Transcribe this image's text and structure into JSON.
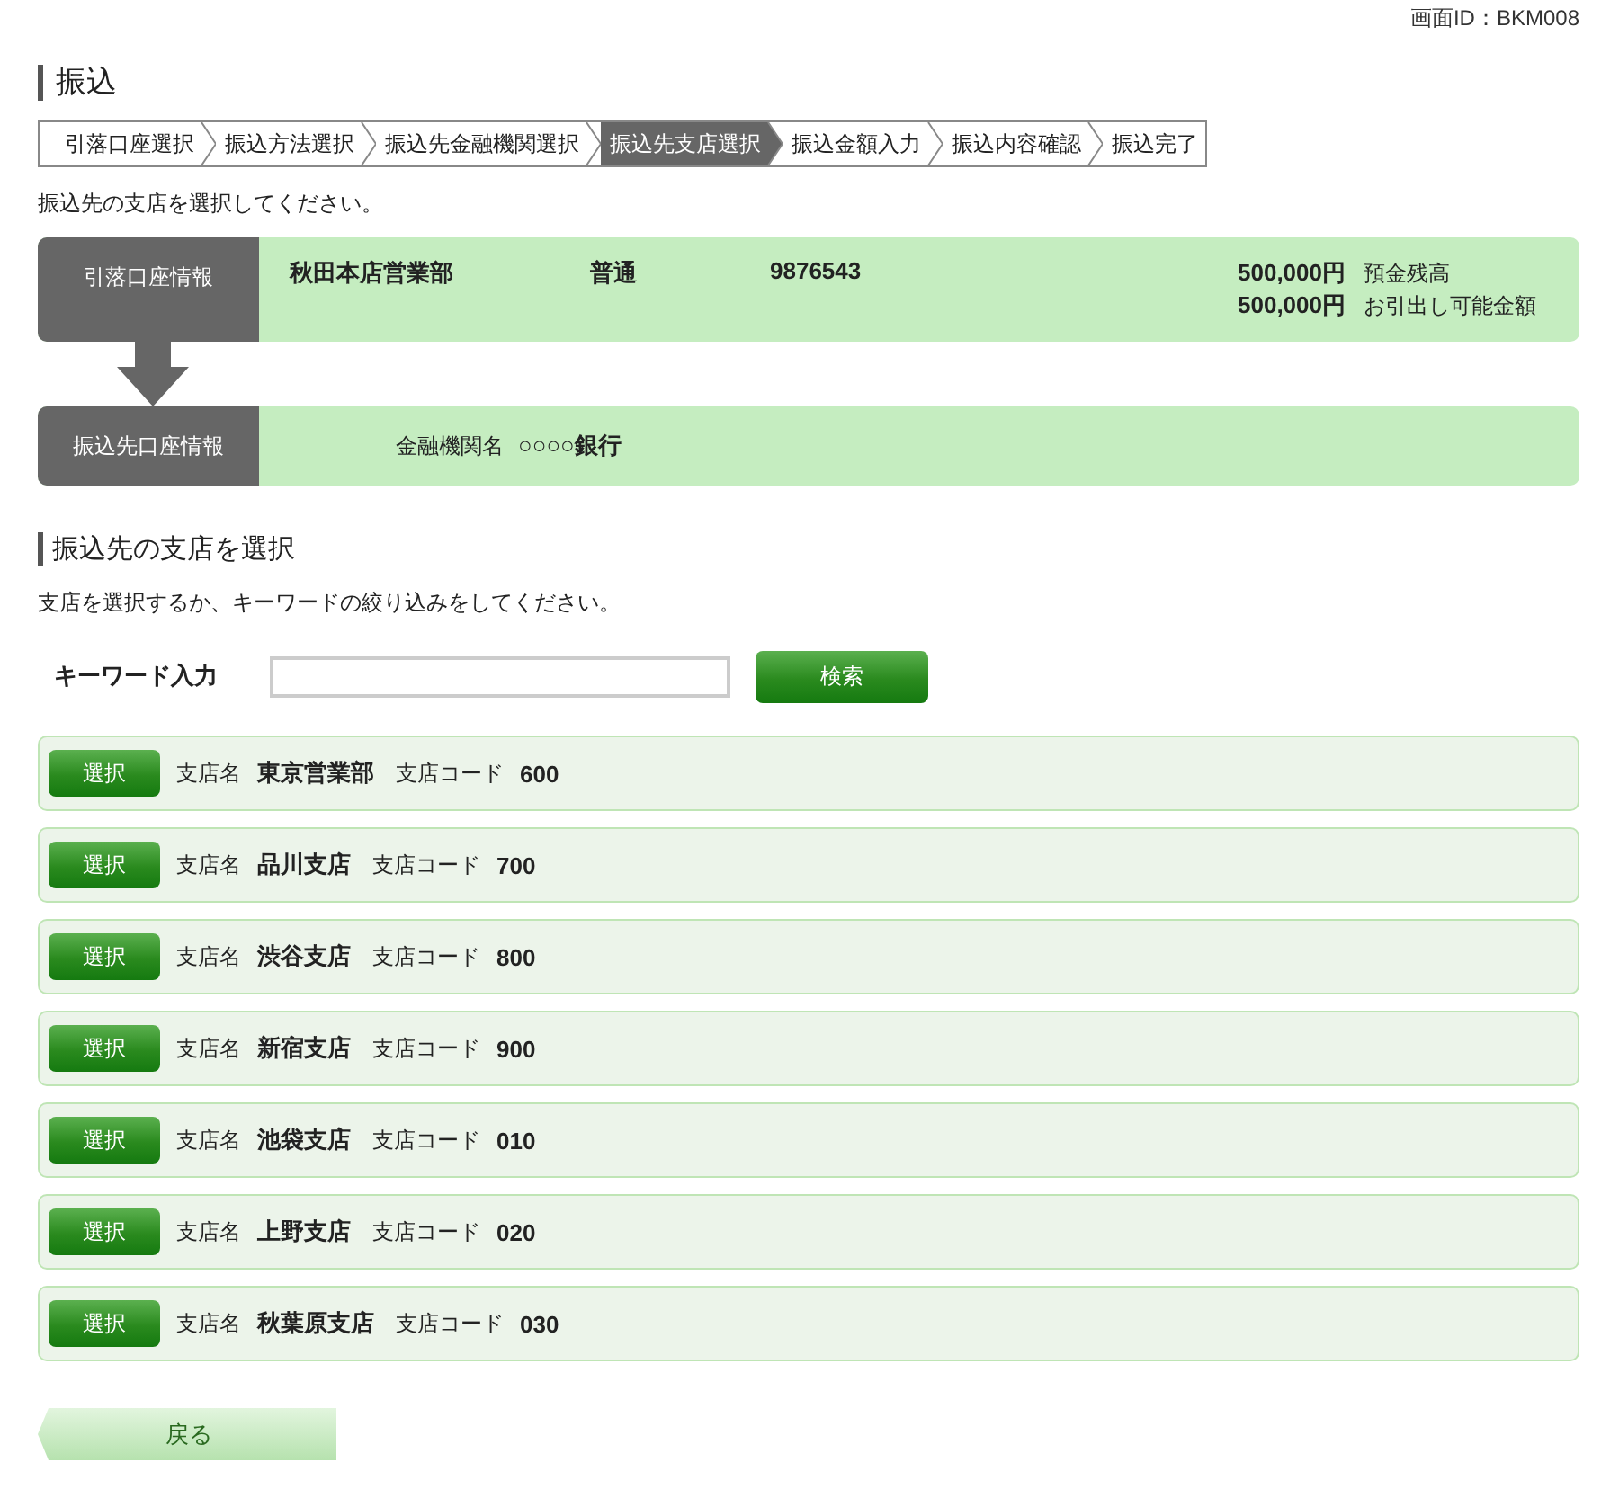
{
  "screen_id": "画面ID：BKM008",
  "title": "振込",
  "steps": [
    {
      "label": "引落口座選択",
      "selected": false
    },
    {
      "label": "振込方法選択",
      "selected": false
    },
    {
      "label": "振込先金融機関選択",
      "selected": false
    },
    {
      "label": "振込先支店選択",
      "selected": true
    },
    {
      "label": "振込金額入力",
      "selected": false
    },
    {
      "label": "振込内容確認",
      "selected": false
    },
    {
      "label": "振込完了",
      "selected": false
    }
  ],
  "instruction": "振込先の支店を選択してください。",
  "debit_account": {
    "label": "引落口座情報",
    "branch": "秋田本店営業部",
    "type": "普通",
    "number": "9876543",
    "balances": [
      {
        "amount": "500,000円",
        "label": "預金残高"
      },
      {
        "amount": "500,000円",
        "label": "お引出し可能金額"
      }
    ]
  },
  "transfer_account": {
    "label": "振込先口座情報",
    "bank_label": "金融機関名",
    "bank_name": "○○○○銀行"
  },
  "branch_section": {
    "title": "振込先の支店を選択",
    "description": "支店を選択するか、キーワードの絞り込みをしてください。"
  },
  "keyword": {
    "label": "キーワード入力",
    "search_button": "検索"
  },
  "branches": [
    {
      "button": "選択",
      "name_label": "支店名",
      "name": "東京営業部",
      "code_label": "支店コード",
      "code": "600"
    },
    {
      "button": "選択",
      "name_label": "支店名",
      "name": "品川支店",
      "code_label": "支店コード",
      "code": "700"
    },
    {
      "button": "選択",
      "name_label": "支店名",
      "name": "渋谷支店",
      "code_label": "支店コード",
      "code": "800"
    },
    {
      "button": "選択",
      "name_label": "支店名",
      "name": "新宿支店",
      "code_label": "支店コード",
      "code": "900"
    },
    {
      "button": "選択",
      "name_label": "支店名",
      "name": "池袋支店",
      "code_label": "支店コード",
      "code": "010"
    },
    {
      "button": "選択",
      "name_label": "支店名",
      "name": "上野支店",
      "code_label": "支店コード",
      "code": "020"
    },
    {
      "button": "選択",
      "name_label": "支店名",
      "name": "秋葉原支店",
      "code_label": "支店コード",
      "code": "030"
    }
  ],
  "back_button": "戻る"
}
